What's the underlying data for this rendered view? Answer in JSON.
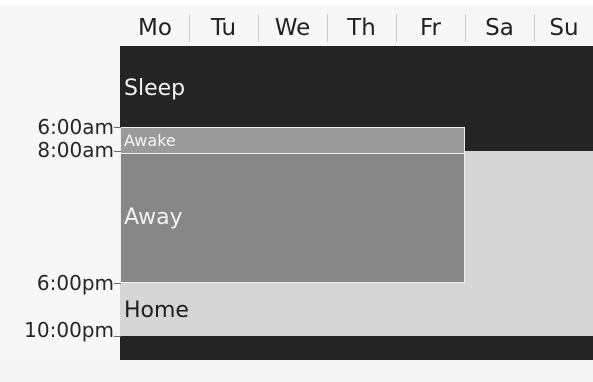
{
  "days": [
    "Mo",
    "Tu",
    "We",
    "Th",
    "Fr",
    "Sa",
    "Su"
  ],
  "times": [
    "6:00am",
    "8:00am",
    "6:00pm",
    "10:00pm"
  ],
  "blocks": {
    "sleep": "Sleep",
    "awake": "Awake",
    "away": "Away",
    "home": "Home"
  },
  "colors": {
    "sleep": "#242424",
    "home": "#d6d6d6",
    "away": "#878787",
    "awake": "#9a9a9a"
  }
}
